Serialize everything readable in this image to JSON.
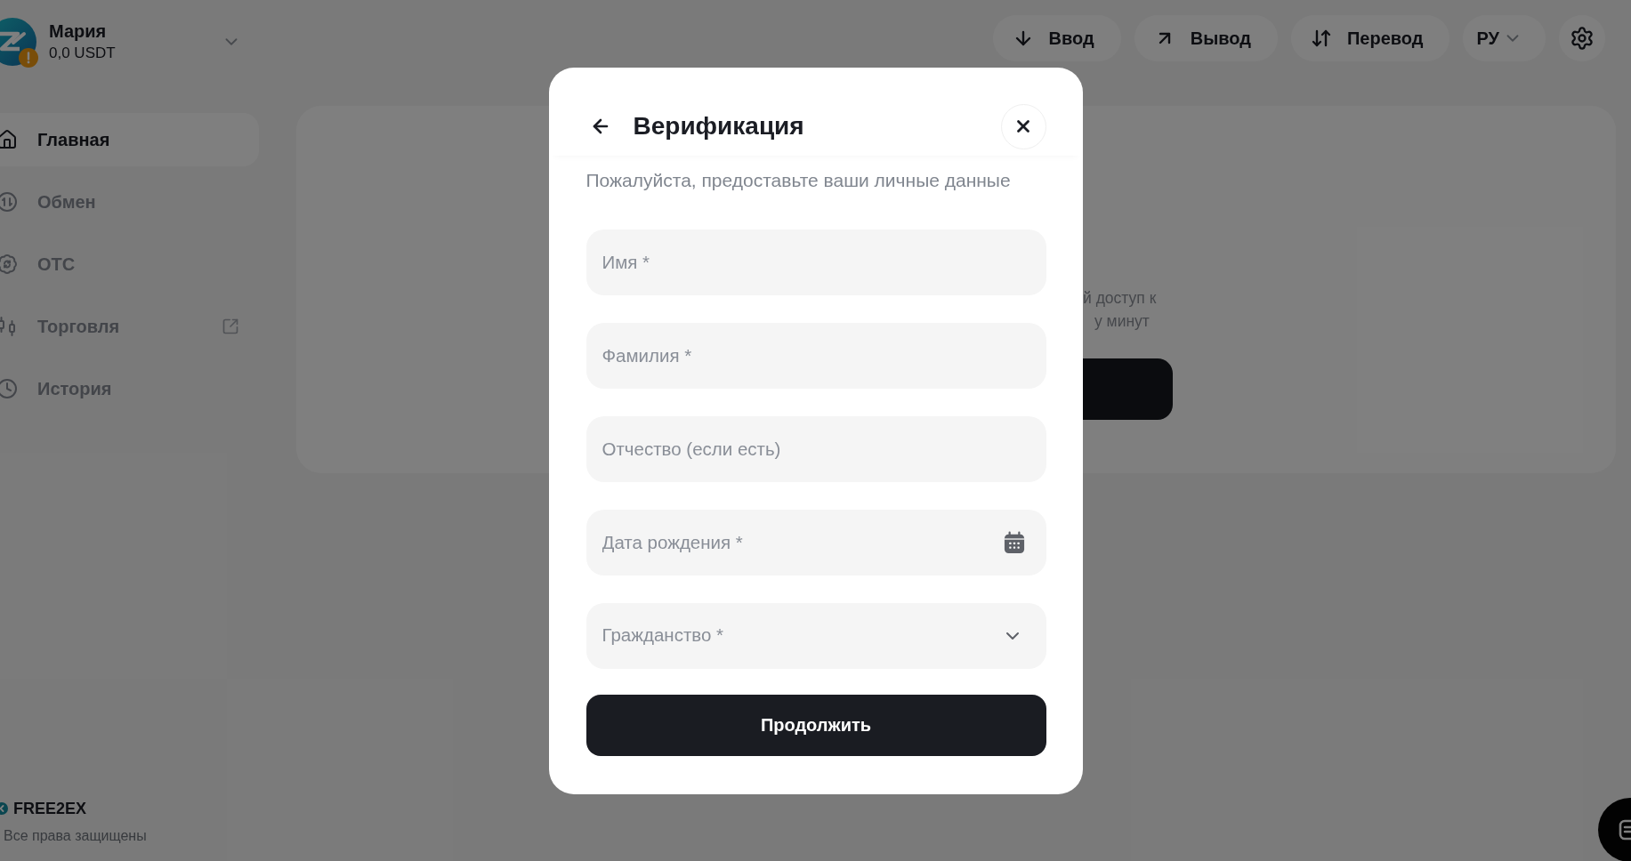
{
  "user": {
    "name": "Мария",
    "balance": "0,0 USDT",
    "warning": true
  },
  "sidebar": {
    "items": [
      {
        "label": "Главная",
        "selected": true,
        "external": false
      },
      {
        "label": "Обмен",
        "selected": false,
        "external": false
      },
      {
        "label": "OTC",
        "selected": false,
        "external": false
      },
      {
        "label": "Торговля",
        "selected": false,
        "external": true
      },
      {
        "label": "История",
        "selected": false,
        "external": false
      }
    ]
  },
  "footer": {
    "brand": "FREE2EX",
    "copyright": "Все права защищены"
  },
  "top_bar": {
    "actions": [
      {
        "label": "Ввод"
      },
      {
        "label": "Вывод"
      },
      {
        "label": "Перевод"
      }
    ],
    "language": "РУ"
  },
  "background_card": {
    "text_lines": [
      "й доступ к",
      "у минут"
    ]
  },
  "modal": {
    "title": "Верификация",
    "subtitle": "Пожалуйста, предоставьте ваши личные данные",
    "fields": [
      {
        "kind": "text",
        "placeholder": "Имя *"
      },
      {
        "kind": "text",
        "placeholder": "Фамилия *"
      },
      {
        "kind": "text",
        "placeholder": "Отчество (если есть)"
      },
      {
        "kind": "date",
        "placeholder": "Дата рождения *"
      },
      {
        "kind": "select",
        "placeholder": "Гражданство *"
      }
    ],
    "submit": "Продолжить"
  }
}
